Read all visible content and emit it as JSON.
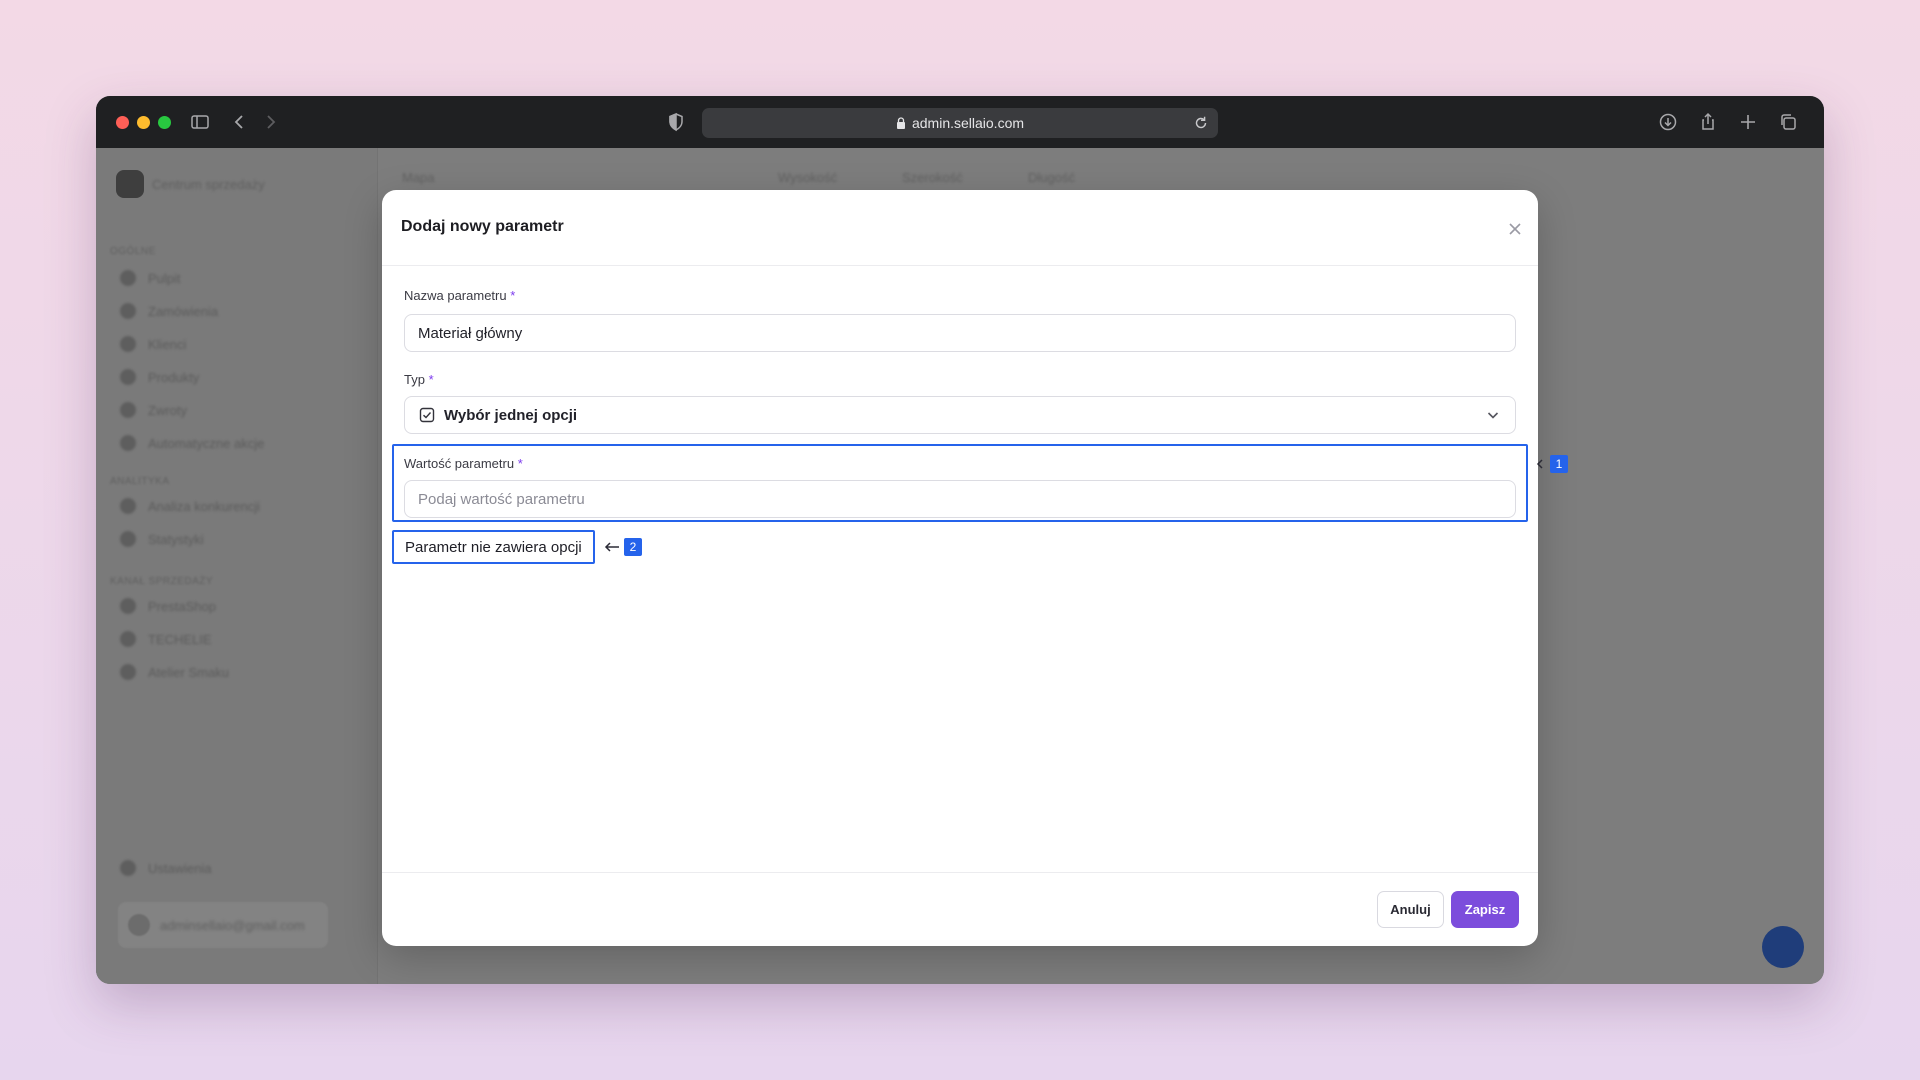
{
  "browser": {
    "url": "admin.sellaio.com"
  },
  "background_app": {
    "sidebar_title": "Centrum sprzedaży",
    "sections": [
      {
        "heading": "OGÓLNE",
        "items": [
          "Pulpit",
          "Zamówienia",
          "Klienci",
          "Produkty",
          "Zwroty",
          "Automatyczne akcje"
        ]
      },
      {
        "heading": "ANALITYKA",
        "items": [
          "Analiza konkurencji",
          "Statystyki"
        ]
      },
      {
        "heading": "KANAŁ SPRZEDAŻY",
        "items": [
          "PrestaShop",
          "TECHELIE",
          "Atelier Smaku"
        ]
      }
    ],
    "settings_label": "Ustawienia",
    "user_email": "adminsellaio@gmail.com",
    "table_headers": [
      "Mapa",
      "Wysokość",
      "Szerokość",
      "Długość"
    ]
  },
  "modal": {
    "title": "Dodaj nowy parametr",
    "name_label": "Nazwa parametru",
    "name_value": "Materiał główny",
    "type_label": "Typ",
    "type_value": "Wybór jednej opcji",
    "value_label": "Wartość parametru",
    "value_placeholder": "Podaj wartość parametru",
    "required_mark": "*",
    "no_options_text": "Parametr nie zawiera opcji",
    "cancel_label": "Anuluj",
    "save_label": "Zapisz"
  },
  "annotations": [
    {
      "number": "1"
    },
    {
      "number": "2"
    }
  ],
  "colors": {
    "accent": "#7c4ddc",
    "annotation": "#2563eb"
  }
}
